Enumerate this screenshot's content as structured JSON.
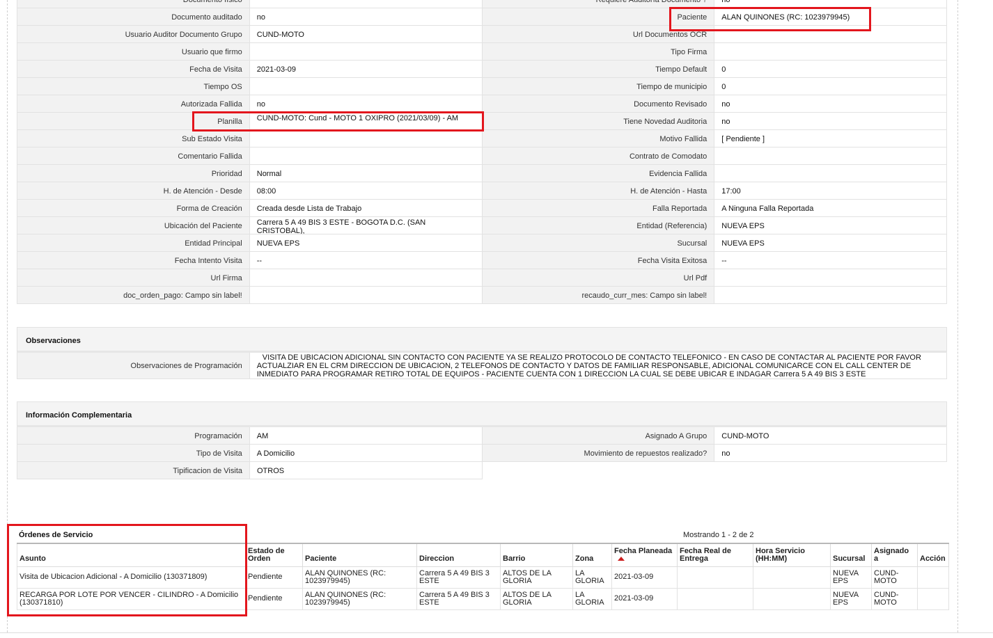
{
  "details": {
    "rows": [
      {
        "l1": "Documento físico",
        "v1": "",
        "l2": "Requiere Auditoría Documento ?",
        "v2": "no"
      },
      {
        "l1": "Documento auditado",
        "v1": "no",
        "l2": "Paciente",
        "v2": "ALAN QUINONES (RC: 1023979945)"
      },
      {
        "l1": "Usuario Auditor Documento Grupo",
        "v1": "CUND-MOTO",
        "l2": "Url Documentos OCR",
        "v2": ""
      },
      {
        "l1": "Usuario que firmo",
        "v1": "",
        "l2": "Tipo Firma",
        "v2": ""
      },
      {
        "l1": "Fecha de Visita",
        "v1": "2021-03-09",
        "l2": "Tiempo Default",
        "v2": "0"
      },
      {
        "l1": "Tiempo OS",
        "v1": "",
        "l2": "Tiempo de municipio",
        "v2": "0"
      },
      {
        "l1": "Autorizada Fallida",
        "v1": "no",
        "l2": "Documento Revisado",
        "v2": "no"
      },
      {
        "l1": "Planilla",
        "v1": "CUND-MOTO: Cund - MOTO 1 OXIPRO (2021/03/09) - AM",
        "l2": "Tiene Novedad Auditoria",
        "v2": "no"
      },
      {
        "l1": "Sub Estado Visita",
        "v1": "",
        "l2": "Motivo Fallida",
        "v2": "[ Pendiente ]"
      },
      {
        "l1": "Comentario Fallida",
        "v1": "",
        "l2": "Contrato de Comodato",
        "v2": ""
      },
      {
        "l1": "Prioridad",
        "v1": "Normal",
        "l2": "Evidencia Fallida",
        "v2": ""
      },
      {
        "l1": "H. de Atención - Desde",
        "v1": "08:00",
        "l2": "H. de Atención - Hasta",
        "v2": "17:00"
      },
      {
        "l1": "Forma de Creación",
        "v1": "Creada desde Lista de Trabajo",
        "l2": "Falla Reportada",
        "v2": "A Ninguna Falla Reportada"
      },
      {
        "l1": "Ubicación del Paciente",
        "v1": "Carrera 5 A 49 BIS 3 ESTE - BOGOTA D.C. (SAN CRISTOBAL),",
        "l2": "Entidad (Referencia)",
        "v2": "NUEVA EPS"
      },
      {
        "l1": "Entidad Principal",
        "v1": "NUEVA EPS",
        "l2": "Sucursal",
        "v2": "NUEVA EPS"
      },
      {
        "l1": "Fecha Intento Visita",
        "v1": "--",
        "l2": "Fecha Visita Exitosa",
        "v2": "--"
      },
      {
        "l1": "Url Firma",
        "v1": "",
        "l2": "Url Pdf",
        "v2": ""
      },
      {
        "l1": "doc_orden_pago: Campo sin label!",
        "v1": "",
        "l2": "recaudo_curr_mes: Campo sin label!",
        "v2": ""
      }
    ]
  },
  "observaciones": {
    "title": "Observaciones",
    "label": "Observaciones de Programación",
    "value": "VISITA DE UBICACION ADICIONAL SIN CONTACTO CON PACIENTE YA SE REALIZO PROTOCOLO DE CONTACTO TELEFONICO - EN CASO DE CONTACTAR AL PACIENTE POR FAVOR ACTUALZIAR EN EL CRM DIRECCION DE UBICACION, 2 TELEFONOS DE CONTACTO Y DATOS DE FAMILIAR RESPONSABLE, ADICIONAL COMUNICARCE CON EL CALL CENTER DE INMEDIATO PARA PROGRAMAR RETIRO TOTAL DE EQUIPOS - PACIENTE CUENTA CON 1 DIRECCION LA CUAL SE DEBE UBICAR E INDAGAR Carrera 5 A 49 BIS 3 ESTE"
  },
  "complementaria": {
    "title": "Información Complementaria",
    "rows": [
      {
        "l1": "Programación",
        "v1": "AM",
        "l2": "Asignado A Grupo",
        "v2": "CUND-MOTO"
      },
      {
        "l1": "Tipo de Visita",
        "v1": "A Domicilio",
        "l2": "Movimiento de repuestos realizado?",
        "v2": "no"
      },
      {
        "l1": "Tipificacion de Visita",
        "v1": "OTROS"
      }
    ]
  },
  "ordenes": {
    "title": "Órdenes de Servicio",
    "showing": "Mostrando 1 - 2 de 2",
    "columns": [
      "Asunto",
      "Estado de Orden",
      "Paciente",
      "Direccion",
      "Barrio",
      "Zona",
      "Fecha Planeada",
      "Fecha Real de Entrega",
      "Hora Servicio (HH:MM)",
      "Sucursal",
      "Asignado a",
      "Acción"
    ],
    "rows": [
      {
        "asunto": "Visita de Ubicacion Adicional - A Domicilio (130371809)",
        "estado": "Pendiente",
        "paciente": "ALAN QUINONES (RC: 1023979945)",
        "direccion": "Carrera 5 A 49 BIS 3 ESTE",
        "barrio": "ALTOS DE LA GLORIA",
        "zona": "LA GLORIA",
        "fecha_planeada": "2021-03-09",
        "fecha_real": "",
        "hora": "",
        "sucursal": "NUEVA EPS",
        "asignado": "CUND-MOTO",
        "accion": ""
      },
      {
        "asunto": "RECARGA POR LOTE POR VENCER - CILINDRO - A Domicilio (130371810)",
        "estado": "Pendiente",
        "paciente": "ALAN QUINONES (RC: 1023979945)",
        "direccion": "Carrera 5 A 49 BIS 3 ESTE",
        "barrio": "ALTOS DE LA GLORIA",
        "zona": "LA GLORIA",
        "fecha_planeada": "2021-03-09",
        "fecha_real": "",
        "hora": "",
        "sucursal": "NUEVA EPS",
        "asignado": "CUND-MOTO",
        "accion": ""
      }
    ]
  },
  "colors": {
    "highlight": "#e3161d",
    "sort_arrow": "#cc1f1f"
  }
}
